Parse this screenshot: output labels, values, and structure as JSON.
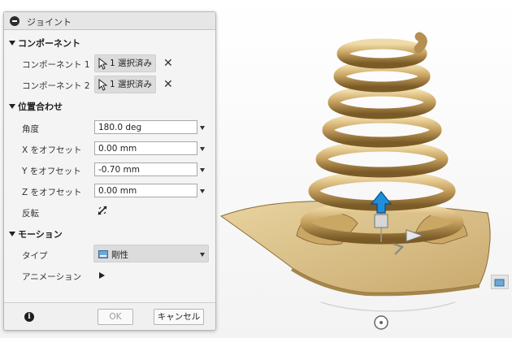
{
  "dialog": {
    "title": "ジョイント",
    "sections": {
      "component": "コンポーネント",
      "alignment": "位置合わせ",
      "motion": "モーション"
    },
    "components": [
      {
        "label": "コンポーネント 1",
        "selection": "1 選択済み"
      },
      {
        "label": "コンポーネント 2",
        "selection": "1 選択済み"
      }
    ],
    "fields": {
      "angle": {
        "label": "角度",
        "value": "180.0 deg"
      },
      "offset_x": {
        "label": "X をオフセット",
        "value": "0.00 mm"
      },
      "offset_y": {
        "label": "Y をオフセット",
        "value": "-0.70 mm"
      },
      "offset_z": {
        "label": "Z をオフセット",
        "value": "0.00 mm"
      }
    },
    "flip_label": "反転",
    "type_label": "タイプ",
    "type_value": "剛性",
    "animation_label": "アニメーション",
    "ok": "OK",
    "cancel": "キャンセル"
  },
  "colors": {
    "spring": "#c9a867",
    "base": "#d8c08a",
    "arrow": "#1f8fdc"
  },
  "icons": [
    "collapse-icon",
    "cursor-select-icon",
    "clear-icon",
    "dropdown-icon",
    "flip-icon",
    "joint-type-icon",
    "play-icon",
    "info-icon"
  ]
}
